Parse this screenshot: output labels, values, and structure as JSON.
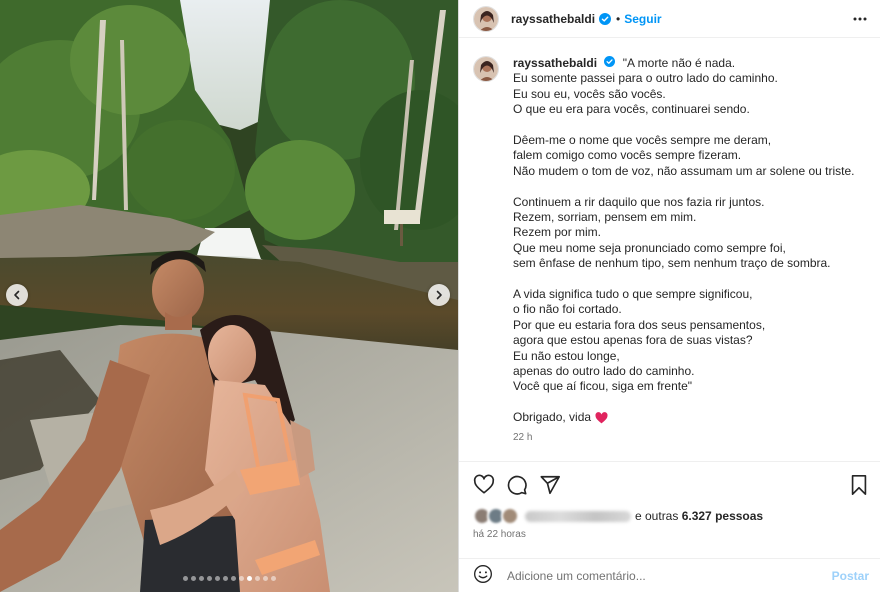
{
  "post": {
    "username": "rayssathebaldi",
    "follow_label": "Seguir",
    "separator": "•",
    "caption_lines": [
      "\"A morte não é nada.",
      "Eu somente passei para o outro lado do caminho.",
      "Eu sou eu, vocês são vocês.",
      "O que eu era para vocês, continuarei sendo.",
      "",
      "Dêem-me o nome que vocês sempre me deram,",
      "falem comigo como vocês sempre fizeram.",
      "Não mudem o tom de voz, não assumam um ar solene ou triste.",
      "",
      "Continuem a rir daquilo que nos fazia rir juntos.",
      "Rezem, sorriam, pensem em mim.",
      "Rezem por mim.",
      "Que meu nome seja pronunciado como sempre foi,",
      "sem ênfase de nenhum tipo, sem nenhum traço de sombra.",
      "",
      "A vida significa tudo o que sempre significou,",
      "o fio não foi cortado.",
      "Por que eu estaria fora dos seus pensamentos,",
      "agora que estou apenas fora de suas vistas?",
      "Eu não estou longe,",
      "apenas do outro lado do caminho.",
      "Você que aí ficou, siga em frente\"",
      ""
    ],
    "thanks_line": "Obrigado, vida",
    "comment_age": "22 h",
    "likes_suffix": "e outras",
    "likes_count": "6.327 pessoas",
    "posted_ago": "há 22 horas",
    "comment_placeholder": "Adicione um comentário...",
    "post_label": "Postar"
  },
  "carousel": {
    "total_slides": 12,
    "active_index": 8
  },
  "icons": {
    "verified": "verified-badge-icon",
    "more": "more-options-icon",
    "like": "heart-icon",
    "comment": "comment-icon",
    "share": "share-icon",
    "save": "bookmark-icon",
    "emoji": "emoji-icon",
    "prev": "chevron-left-icon",
    "next": "chevron-right-icon"
  },
  "colors": {
    "link_blue": "#0095f6",
    "verified_blue": "#0095f6",
    "heart_red": "#e0245e",
    "muted_text": "#737373",
    "post_button_disabled": "#9dd1fa"
  }
}
